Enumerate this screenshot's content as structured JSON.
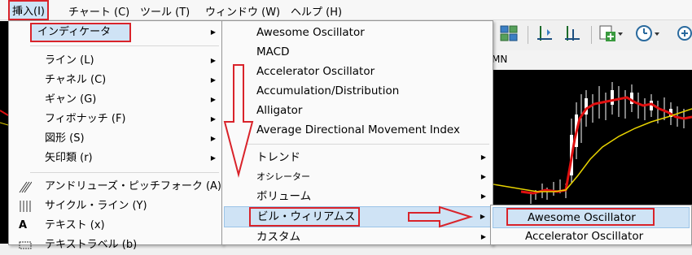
{
  "menubar": {
    "items": [
      {
        "label": "挿入(I)"
      },
      {
        "label": "チャート (C)"
      },
      {
        "label": "ツール (T)"
      },
      {
        "label": "ウィンドウ (W)"
      },
      {
        "label": "ヘルプ (H)"
      }
    ]
  },
  "insert_menu": {
    "items": [
      {
        "label": "インディケータ"
      },
      {
        "label": "ライン (L)"
      },
      {
        "label": "チャネル (C)"
      },
      {
        "label": "ギャン (G)"
      },
      {
        "label": "フィボナッチ (F)"
      },
      {
        "label": "図形 (S)"
      },
      {
        "label": "矢印類 (r)"
      },
      {
        "label": "アンドリューズ・ピッチフォーク (A)"
      },
      {
        "label": "サイクル・ライン (Y)"
      },
      {
        "label": "テキスト (x)"
      },
      {
        "label": "テキストラベル (b)"
      }
    ]
  },
  "indicator_menu": {
    "items": [
      {
        "label": "Awesome Oscillator"
      },
      {
        "label": "MACD"
      },
      {
        "label": "Accelerator Oscillator"
      },
      {
        "label": "Accumulation/Distribution"
      },
      {
        "label": "Alligator"
      },
      {
        "label": "Average Directional Movement Index"
      },
      {
        "label": "トレンド"
      },
      {
        "label": "オシレーター"
      },
      {
        "label": "ボリューム"
      },
      {
        "label": "ビル・ウィリアムス"
      },
      {
        "label": "カスタム"
      }
    ]
  },
  "bill_williams_menu": {
    "items": [
      {
        "label": "Awesome Oscillator"
      },
      {
        "label": "Accelerator Oscillator"
      }
    ]
  },
  "chart_tabs": {
    "mn_label": "MN"
  },
  "colors": {
    "highlight": "#cfe3f5",
    "annotation_red": "#d9232a",
    "chart_bg": "#000000"
  }
}
